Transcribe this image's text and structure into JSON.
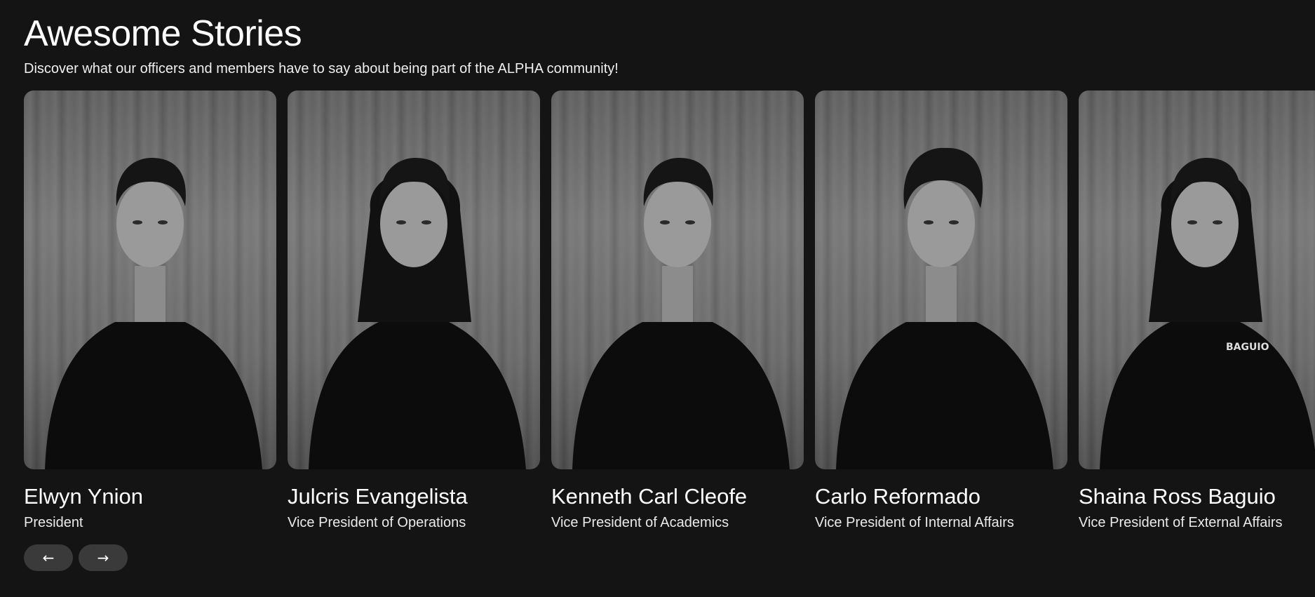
{
  "section": {
    "title": "Awesome Stories",
    "subtitle": "Discover what our officers and members have to say about being part of the ALPHA community!"
  },
  "cards": [
    {
      "name": "Elwyn Ynion",
      "role": "President",
      "hair": "short"
    },
    {
      "name": "Julcris Evangelista",
      "role": "Vice President of Operations",
      "hair": "long"
    },
    {
      "name": "Kenneth Carl Cleofe",
      "role": "Vice President of Academics",
      "hair": "short"
    },
    {
      "name": "Carlo Reformado",
      "role": "Vice President of Internal Affairs",
      "hair": "curly"
    },
    {
      "name": "Shaina Ross Baguio",
      "role": "Vice President of External Affairs",
      "hair": "long"
    }
  ],
  "shirt_logo_text": "BAGUIO",
  "nav": {
    "prev_icon": "arrow-left-icon",
    "next_icon": "arrow-right-icon",
    "prev_glyph": "←",
    "next_glyph": "→"
  },
  "colors": {
    "background": "#141414",
    "text": "#ffffff",
    "button": "#3a3a3a"
  }
}
